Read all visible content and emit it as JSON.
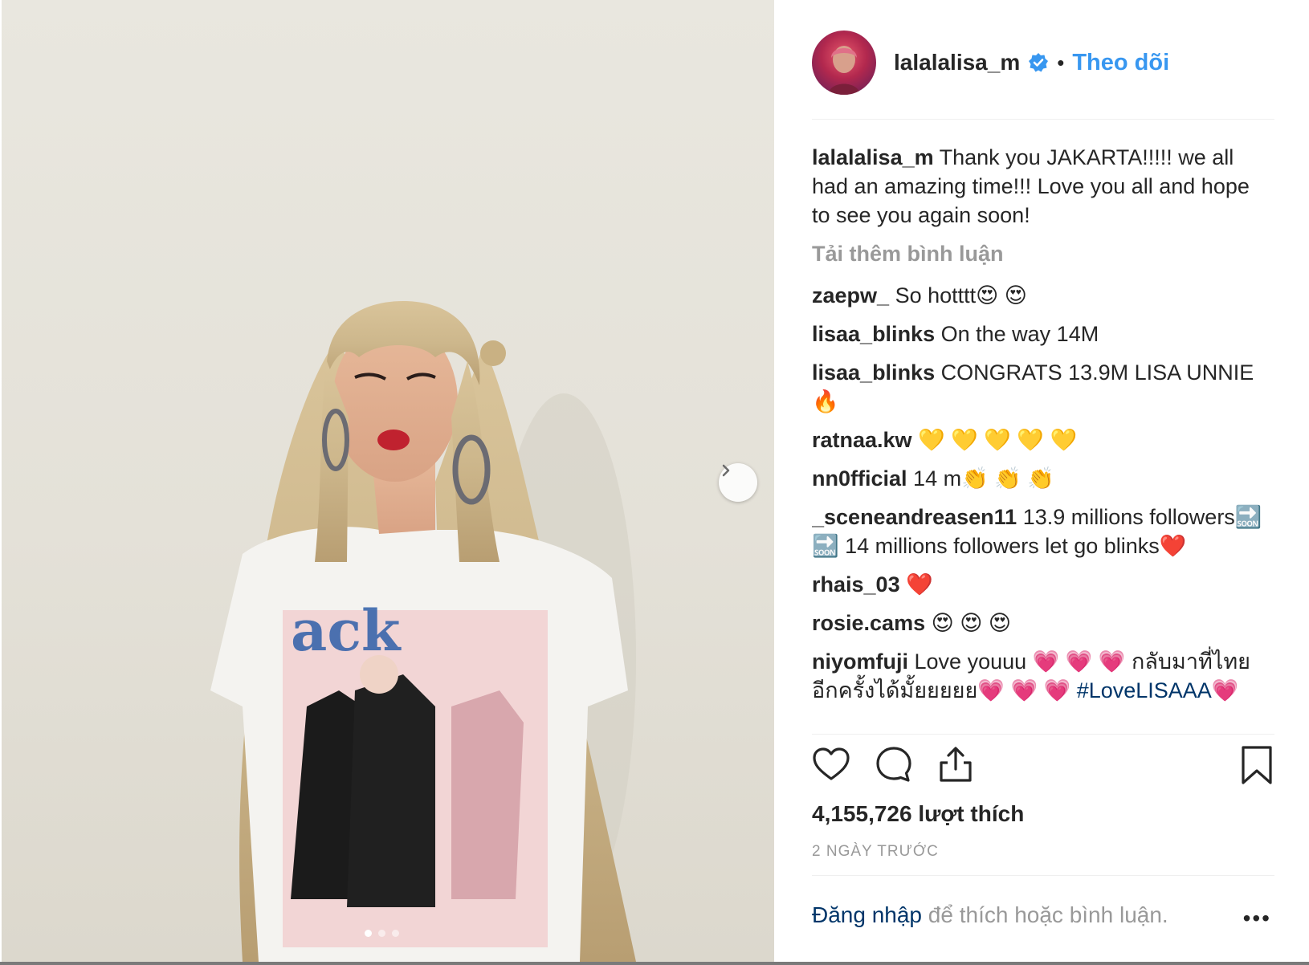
{
  "post": {
    "username": "lalalalisa_m",
    "follow_label": "Theo dõi",
    "separator": "•",
    "caption": "Thank you JAKARTA!!!!! we all had an amazing time!!! Love you all and hope to see you again soon!",
    "load_more_label": "Tải thêm bình luận",
    "comments": [
      {
        "user": "zaepw_",
        "text": "So hotttt😍 😍"
      },
      {
        "user": "lisaa_blinks",
        "text": "On the way 14M"
      },
      {
        "user": "lisaa_blinks",
        "text": "CONGRATS 13.9M LISA UNNIE 🔥"
      },
      {
        "user": "ratnaa.kw",
        "text": "💛 💛 💛 💛 💛"
      },
      {
        "user": "nn0fficial",
        "text": "14 m👏 👏 👏"
      },
      {
        "user": "_sceneandreasen11",
        "text": "13.9 millions followers🔜 🔜  14 millions followers let go blinks❤️"
      },
      {
        "user": "rhais_03",
        "text": "❤️"
      },
      {
        "user": "rosie.cams",
        "text": "😍 😍 😍"
      },
      {
        "user": "niyomfuji",
        "text": "Love youuu 💗 💗 💗  กลับมาที่ไทยอีกครั้งได้มั้ยยยยย💗 💗 💗  ",
        "hashtag": "#LoveLISAAA",
        "suffix": "💗"
      }
    ],
    "likes_text": "4,155,726 lượt thích",
    "date_text": "2 NGÀY TRƯỚC",
    "login_link": "Đăng nhập",
    "login_rest": " để thích hoặc bình luận.",
    "more_label": "•••",
    "carousel": {
      "count": 3,
      "active": 0
    }
  },
  "colors": {
    "accent": "#3897f0",
    "link": "#003569",
    "muted": "#999999",
    "text": "#262626"
  },
  "icons": [
    "verified-badge-icon",
    "heart-icon",
    "comment-icon",
    "share-icon",
    "bookmark-icon",
    "chevron-right-icon",
    "more-options-icon"
  ]
}
